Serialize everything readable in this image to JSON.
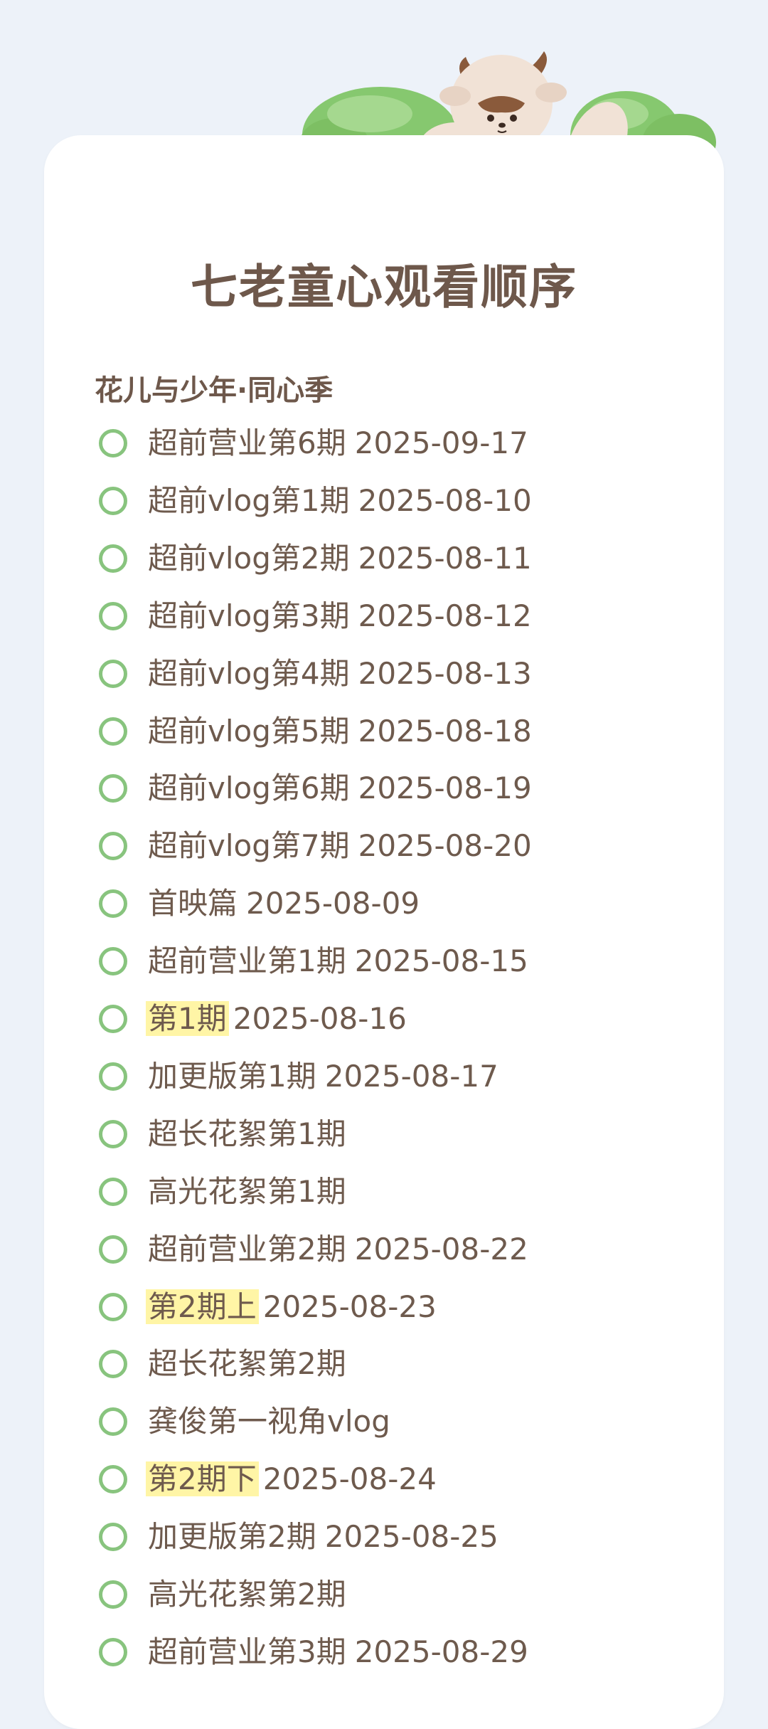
{
  "page": {
    "title": "七老童心观看顺序",
    "section_title": "花儿与少年·同心季"
  },
  "colors": {
    "background": "#edf2f9",
    "card": "#ffffff",
    "text": "#6e5a4d",
    "check_ring": "#88c47e",
    "highlight": "#fff5a6",
    "bush": "#7fc56a"
  },
  "decoration": {
    "mascot_icon": "deer-mascot-icon",
    "bush_icon": "green-bush-icon"
  },
  "episodes": [
    {
      "label": "超前营业第6期",
      "date": "2025-09-17",
      "highlight": false
    },
    {
      "label": "超前vlog第1期",
      "date": "2025-08-10",
      "highlight": false
    },
    {
      "label": "超前vlog第2期",
      "date": "2025-08-11",
      "highlight": false
    },
    {
      "label": "超前vlog第3期",
      "date": "2025-08-12",
      "highlight": false
    },
    {
      "label": "超前vlog第4期",
      "date": "2025-08-13",
      "highlight": false
    },
    {
      "label": "超前vlog第5期",
      "date": "2025-08-18",
      "highlight": false
    },
    {
      "label": "超前vlog第6期",
      "date": "2025-08-19",
      "highlight": false
    },
    {
      "label": "超前vlog第7期",
      "date": "2025-08-20",
      "highlight": false
    },
    {
      "label": "首映篇",
      "date": "2025-08-09",
      "highlight": false
    },
    {
      "label": "超前营业第1期",
      "date": "2025-08-15",
      "highlight": false
    },
    {
      "label": "第1期",
      "date": "2025-08-16",
      "highlight": true
    },
    {
      "label": "加更版第1期",
      "date": "2025-08-17",
      "highlight": false
    },
    {
      "label": "超长花絮第1期",
      "date": "",
      "highlight": false
    },
    {
      "label": "高光花絮第1期",
      "date": "",
      "highlight": false
    },
    {
      "label": "超前营业第2期",
      "date": "2025-08-22",
      "highlight": false
    },
    {
      "label": "第2期上",
      "date": "2025-08-23",
      "highlight": true
    },
    {
      "label": "超长花絮第2期",
      "date": "",
      "highlight": false
    },
    {
      "label": "龚俊第一视角vlog",
      "date": "",
      "highlight": false
    },
    {
      "label": "第2期下",
      "date": "2025-08-24",
      "highlight": true
    },
    {
      "label": "加更版第2期",
      "date": "2025-08-25",
      "highlight": false
    },
    {
      "label": "高光花絮第2期",
      "date": "",
      "highlight": false
    },
    {
      "label": "超前营业第3期",
      "date": "2025-08-29",
      "highlight": false
    }
  ]
}
